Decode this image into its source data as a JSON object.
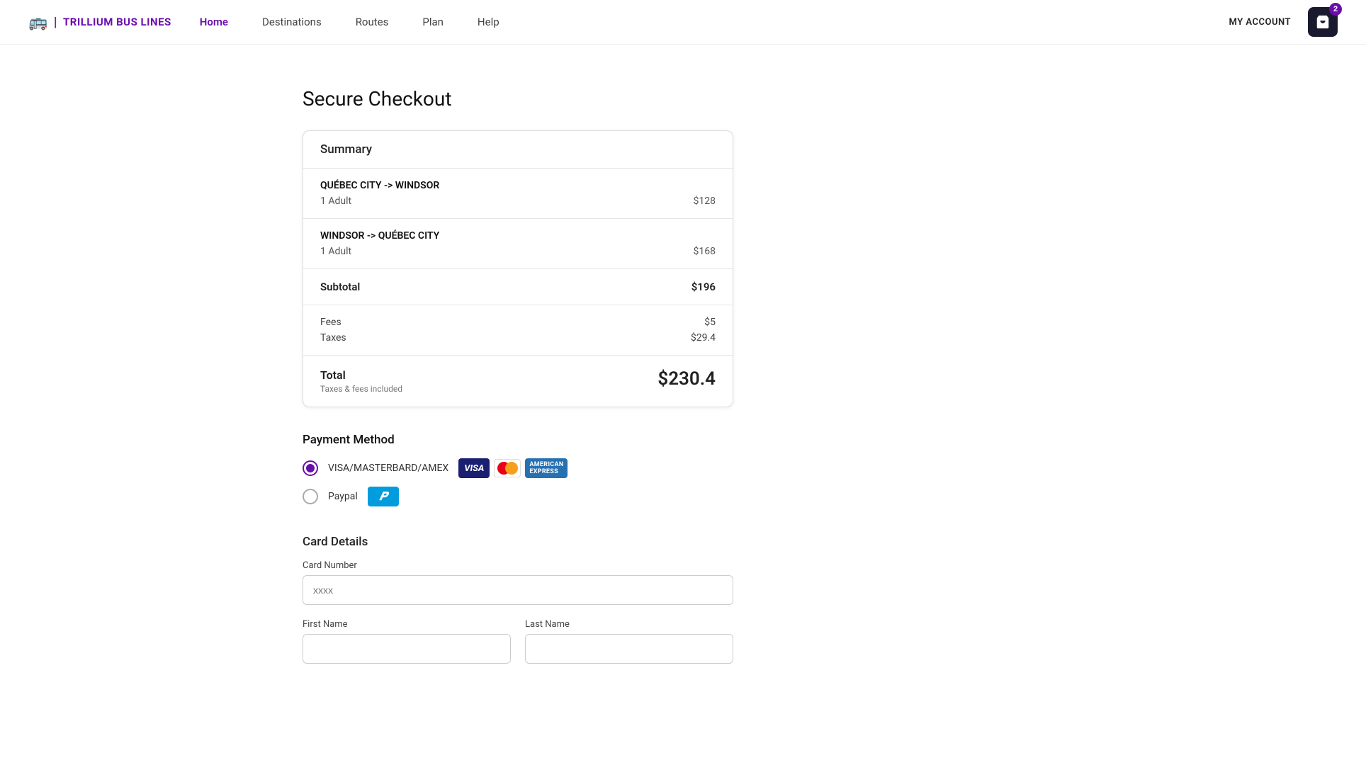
{
  "brand": {
    "name": "TRILLIUM BUS LINES",
    "logo_icon": "🚌"
  },
  "nav": {
    "links": [
      {
        "label": "Home",
        "active": true
      },
      {
        "label": "Destinations",
        "active": false
      },
      {
        "label": "Routes",
        "active": false
      },
      {
        "label": "Plan",
        "active": false
      },
      {
        "label": "Help",
        "active": false
      }
    ],
    "my_account": "MY ACCOUNT",
    "cart_badge": "2"
  },
  "page": {
    "title": "Secure Checkout"
  },
  "summary": {
    "header": "Summary",
    "trip1": {
      "route": "QUÉBEC CITY -> WINDSOR",
      "passengers": "1 Adult",
      "price": "$128"
    },
    "trip2": {
      "route": "WINDSOR -> QUÉBEC CITY",
      "passengers": "1 Adult",
      "price": "$168"
    },
    "subtotal_label": "Subtotal",
    "subtotal_value": "$196",
    "fees_label": "Fees",
    "fees_value": "$5",
    "taxes_label": "Taxes",
    "taxes_value": "$29.4",
    "total_label": "Total",
    "total_note": "Taxes & fees included",
    "total_value": "$230.4"
  },
  "payment": {
    "section_title": "Payment Method",
    "options": [
      {
        "id": "visa",
        "label": "VISA/MASTERBARD/AMEX",
        "selected": true
      },
      {
        "id": "paypal",
        "label": "Paypal",
        "selected": false
      }
    ]
  },
  "card_details": {
    "section_title": "Card Details",
    "card_number_label": "Card Number",
    "card_number_placeholder": "xxxx",
    "first_name_label": "First Name",
    "last_name_label": "Last Name"
  }
}
